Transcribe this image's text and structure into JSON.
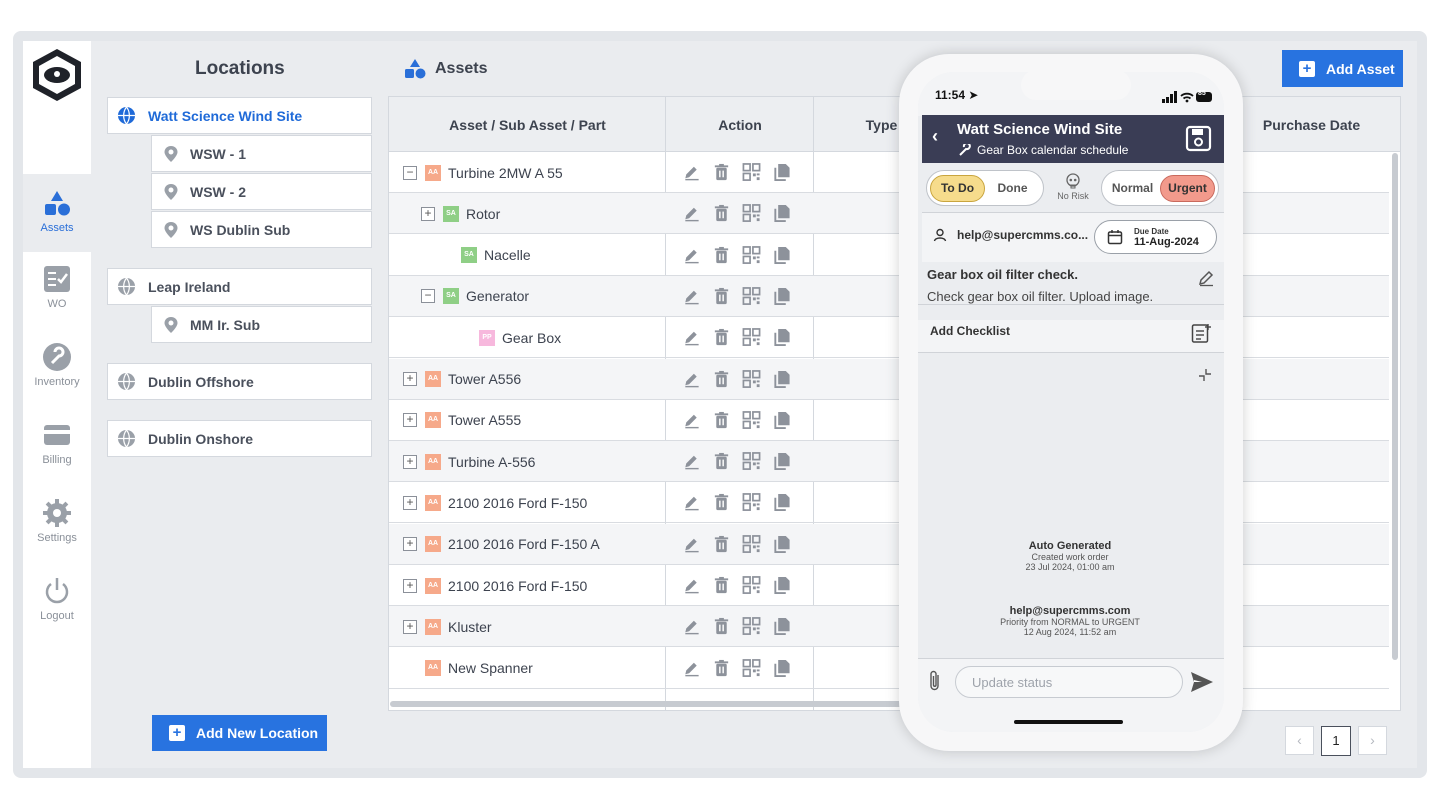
{
  "nav": {
    "items": [
      {
        "label": "Assets",
        "icon": "assets-icon"
      },
      {
        "label": "WO",
        "icon": "work-order-icon"
      },
      {
        "label": "Inventory",
        "icon": "wrench-icon"
      },
      {
        "label": "Billing",
        "icon": "card-icon"
      },
      {
        "label": "Settings",
        "icon": "gear-icon"
      },
      {
        "label": "Logout",
        "icon": "power-icon"
      }
    ]
  },
  "locations": {
    "title": "Locations",
    "groups": [
      {
        "name": "Watt Science Wind Site",
        "subs": [
          "WSW - 1",
          "WSW - 2",
          "WS Dublin Sub"
        ]
      },
      {
        "name": "Leap Ireland",
        "subs": [
          "MM Ir. Sub"
        ]
      },
      {
        "name": "Dublin Offshore",
        "subs": []
      },
      {
        "name": "Dublin Onshore",
        "subs": []
      }
    ],
    "add_button": "Add New Location"
  },
  "assets": {
    "title": "Assets",
    "add_button": "Add Asset",
    "columns": [
      "Asset / Sub Asset / Part",
      "Action",
      "Type",
      "Purchase Date"
    ],
    "rows": [
      {
        "name": "Turbine 2MW A 55",
        "badge": "AA",
        "expander": "−"
      },
      {
        "name": "Rotor",
        "badge": "SA",
        "expander": "+"
      },
      {
        "name": "Nacelle",
        "badge": "SA",
        "expander": ""
      },
      {
        "name": "Generator",
        "badge": "SA",
        "expander": "−"
      },
      {
        "name": "Gear Box",
        "badge": "PP",
        "expander": ""
      },
      {
        "name": "Tower A556",
        "badge": "AA",
        "expander": "+"
      },
      {
        "name": "Tower A555",
        "badge": "AA",
        "expander": "+"
      },
      {
        "name": "Turbine A-556",
        "badge": "AA",
        "expander": "+"
      },
      {
        "name": "2100 2016 Ford F-150",
        "badge": "AA",
        "expander": "+"
      },
      {
        "name": "2100 2016 Ford F-150 A",
        "badge": "AA",
        "expander": "+"
      },
      {
        "name": "2100 2016 Ford F-150",
        "badge": "AA",
        "expander": "+"
      },
      {
        "name": "Kluster",
        "badge": "AA",
        "expander": "+"
      },
      {
        "name": "New Spanner",
        "badge": "AA",
        "expander": ""
      }
    ],
    "pager": {
      "prev": "‹",
      "page": "1",
      "next": "›"
    }
  },
  "phone": {
    "time": "11:54",
    "battery": "85",
    "site": "Watt Science Wind Site",
    "schedule": "Gear Box calendar schedule",
    "status": {
      "todo": "To Do",
      "done": "Done"
    },
    "risk": "No Risk",
    "priority": {
      "normal": "Normal",
      "urgent": "Urgent"
    },
    "assignee": "help@supercmms.co...",
    "due_label": "Due Date",
    "due_value": "11-Aug-2024",
    "task_title": "Gear box oil filter check.",
    "task_desc": "Check gear box oil filter. Upload image.",
    "checklist": "Add Checklist",
    "log": [
      {
        "who": "Auto Generated",
        "what": "Created work order",
        "when": "23 Jul 2024, 01:00 am"
      },
      {
        "who": "help@supercmms.com",
        "what": "Priority from NORMAL to URGENT",
        "when": "12 Aug 2024, 11:52 am"
      }
    ],
    "composer_placeholder": "Update status"
  },
  "colors": {
    "accent": "#2873e0",
    "header": "#3a3d55",
    "todo": "#f6dc8c",
    "urgent": "#f29a8c",
    "badge_aa": "#f6a98a",
    "badge_sa": "#8fcf86",
    "badge_pp": "#f7b8dd"
  }
}
